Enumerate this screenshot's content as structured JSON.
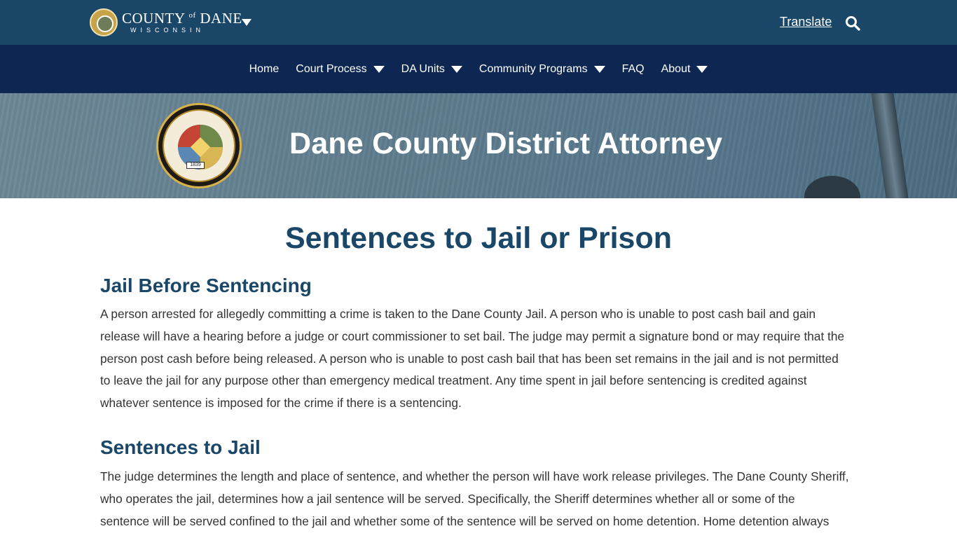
{
  "header": {
    "logo": {
      "main": "COUNTY",
      "of": "of",
      "main2": "DANE",
      "sub": "WISCONSIN"
    },
    "translate_label": "Translate",
    "icons": {
      "search": "search-icon",
      "logo_menu": "chevron-down-icon"
    }
  },
  "nav": {
    "items": [
      {
        "label": "Home",
        "dropdown": false
      },
      {
        "label": "Court Process",
        "dropdown": true
      },
      {
        "label": "DA Units",
        "dropdown": true
      },
      {
        "label": "Community Programs",
        "dropdown": true
      },
      {
        "label": "FAQ",
        "dropdown": false
      },
      {
        "label": "About",
        "dropdown": true
      }
    ]
  },
  "hero": {
    "title": "Dane County District Attorney",
    "seal": {
      "year": "1839"
    }
  },
  "main": {
    "page_title": "Sentences to Jail or Prison",
    "sections": [
      {
        "heading": "Jail Before Sentencing",
        "lines": [
          "A person arrested for allegedly committing a crime is taken to the Dane County Jail. A person who is unable to post cash bail and gain",
          "release will have a hearing before a judge or court commissioner to set bail. The judge may permit a signature bond or may require that the",
          "person post cash before being released. A person who is unable to post cash bail that has been set remains in the jail and is not permitted",
          "to leave the jail for any purpose other than emergency medical treatment. Any time spent in jail before sentencing is credited against",
          "whatever sentence is imposed for the crime if there is a sentencing."
        ]
      },
      {
        "heading": "Sentences to Jail",
        "lines": [
          "The judge determines the length and place of sentence, and whether the person will have work release privileges. The Dane County Sheriff,",
          "who operates the jail, determines how a jail sentence will be served. Specifically, the Sheriff determines whether all or some of the",
          "sentence will be served confined to the jail and whether some of the sentence will be served on home detention. Home detention always"
        ]
      }
    ]
  },
  "colors": {
    "topbar": "#1a4668",
    "nav": "#0d2752",
    "heading": "#1a4668",
    "body_text": "#333333"
  }
}
